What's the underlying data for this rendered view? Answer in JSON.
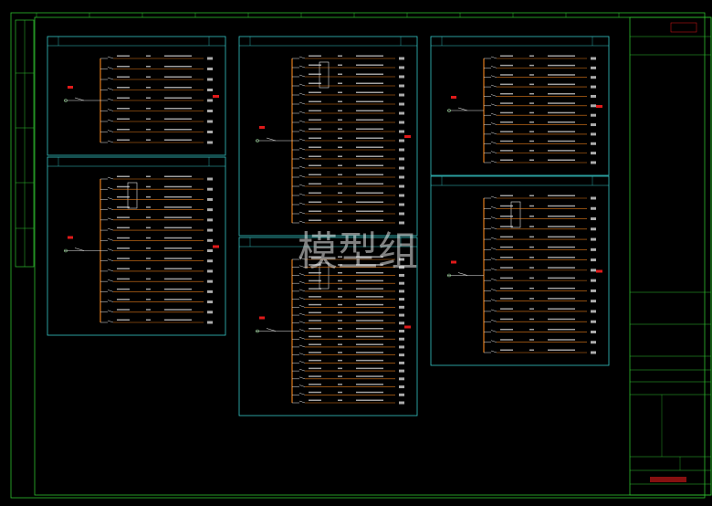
{
  "colors": {
    "frame": "#2fbf2f",
    "panel": "#35c6c6",
    "busbar": "#e07a1a",
    "text": "#e6e6e6",
    "red": "#e01a1a",
    "dim": "#8fd18f"
  },
  "watermark": "模型组",
  "panels": [
    {
      "title": "",
      "code": ""
    },
    {
      "title": "",
      "code": ""
    },
    {
      "title": "",
      "code": ""
    },
    {
      "title": "",
      "code": ""
    },
    {
      "title": "",
      "code": ""
    },
    {
      "title": "",
      "code": ""
    }
  ],
  "title_block": {
    "project_name": "",
    "drawing_title": "",
    "drawing_no": "",
    "scale": "",
    "date": ""
  }
}
